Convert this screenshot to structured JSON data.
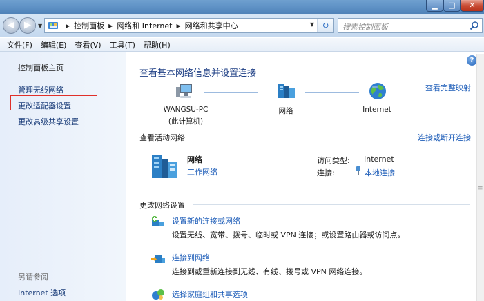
{
  "window": {
    "minimize_glyph": "▁",
    "maximize_glyph": "□",
    "close_glyph": "✕"
  },
  "address_bar": {
    "back_glyph": "◀",
    "forward_glyph": "▶",
    "breadcrumbs": [
      "控制面板",
      "网络和 Internet",
      "网络和共享中心"
    ],
    "refresh_glyph": "↻",
    "search_placeholder": "搜索控制面板"
  },
  "menu": {
    "items": [
      "文件(F)",
      "编辑(E)",
      "查看(V)",
      "工具(T)",
      "帮助(H)"
    ]
  },
  "sidebar": {
    "home": "控制面板主页",
    "items": [
      "管理无线网络",
      "更改适配器设置",
      "更改高级共享设置"
    ],
    "see_also_title": "另请参阅",
    "see_also_items": [
      "Internet 选项"
    ]
  },
  "main": {
    "help_glyph": "?",
    "heading": "查看基本网络信息并设置连接",
    "full_map_link": "查看完整映射",
    "map": {
      "computer_name": "WANGSU-PC",
      "computer_sub": "(此计算机)",
      "network": "网络",
      "internet": "Internet"
    },
    "active_networks": {
      "title": "查看活动网络",
      "connect_link": "连接或断开连接",
      "network_name": "网络",
      "network_category": "工作网络",
      "access_type_label": "访问类型:",
      "access_type_value": "Internet",
      "connections_label": "连接:",
      "connections_value": "本地连接"
    },
    "change_settings": {
      "title": "更改网络设置",
      "tasks": [
        {
          "link": "设置新的连接或网络",
          "desc": "设置无线、宽带、拨号、临时或 VPN 连接；或设置路由器或访问点。"
        },
        {
          "link": "连接到网络",
          "desc": "连接到或重新连接到无线、有线、拨号或 VPN 网络连接。"
        },
        {
          "link": "选择家庭组和共享选项",
          "desc": ""
        }
      ]
    }
  },
  "colors": {
    "link": "#1c5cb8",
    "heading": "#1e3f85",
    "highlight_box": "#e0302a"
  }
}
